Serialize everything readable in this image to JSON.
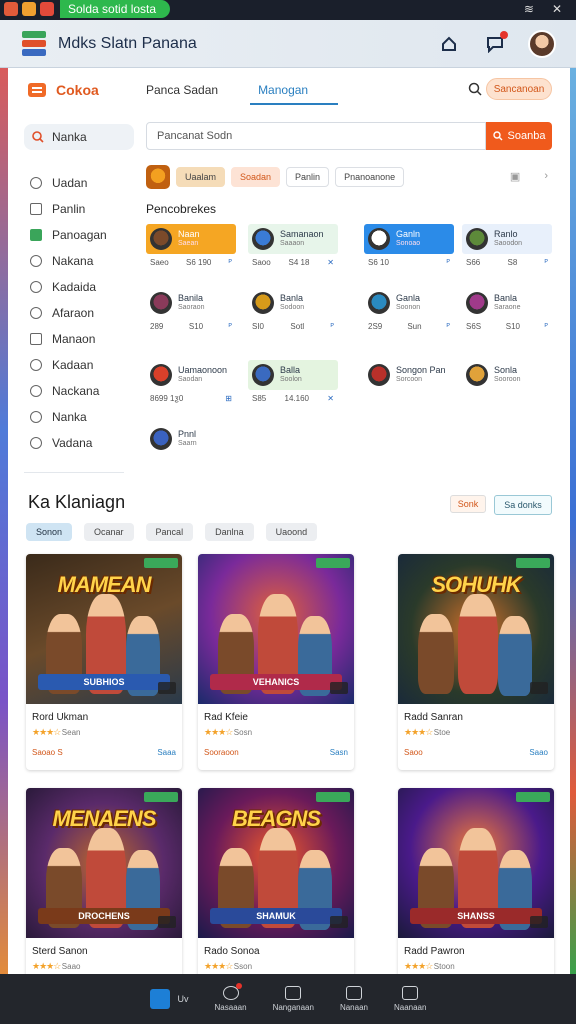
{
  "status": {
    "pill_label": "Solda sotid losta"
  },
  "app": {
    "title": "Mdks Slatn Panana"
  },
  "sidebar": {
    "brand": "Cokoa",
    "search_label": "Nanka",
    "items": [
      {
        "label": "Uadan",
        "icon": "search-icon"
      },
      {
        "label": "Panlin",
        "icon": "doc-icon"
      },
      {
        "label": "Panoagan",
        "icon": "flag-icon"
      },
      {
        "label": "Nakana",
        "icon": "circle-icon"
      },
      {
        "label": "Kadaida",
        "icon": "circle-icon"
      },
      {
        "label": "Afaraon",
        "icon": "clock-icon"
      },
      {
        "label": "Manaon",
        "icon": "doc-icon"
      },
      {
        "label": "Kadaan",
        "icon": "chat-icon"
      },
      {
        "label": "Nackana",
        "icon": "settings-icon"
      },
      {
        "label": "Nanka",
        "icon": "info-icon"
      },
      {
        "label": "Vadana",
        "icon": "gear-icon"
      }
    ]
  },
  "tabs": [
    "Panca Sadan",
    "Manogan"
  ],
  "top_pill": "Sancanoan",
  "search": {
    "placeholder": "Pancanat Sodn",
    "button": "Soanba"
  },
  "chips": [
    "Uaalam",
    "Soadan",
    "Panlin",
    "Pnanoanone"
  ],
  "section_label": "Pencobrekes",
  "mini_cards": [
    {
      "name": "Naan",
      "sub": "Saean",
      "m1": "Saeo",
      "m2": "S6 190",
      "m3": "ᴾ",
      "color": "#f5a623",
      "text": "#fff",
      "icon": "#7b4a2a"
    },
    {
      "name": "Samanaon",
      "sub": "Saaaon",
      "m1": "Saoo",
      "m2": "S4 18",
      "m3": "✕",
      "color": "#e7f5ea",
      "text": "#2d3a4a",
      "icon": "#3a7bd5"
    },
    {
      "name": "Ganln",
      "sub": "Sonoao",
      "m1": "S6 10",
      "m2": "",
      "m3": "ᴾ",
      "color": "#2b8be8",
      "text": "#fff",
      "icon": "#ffffff"
    },
    {
      "name": "Ranlo",
      "sub": "Saoodon",
      "m1": "S66",
      "m2": "S8",
      "m3": "ᴾ",
      "color": "#e8f0fb",
      "text": "#2d3a4a",
      "icon": "#5d8a3a"
    },
    {
      "name": "Banila",
      "sub": "Saoraon",
      "m1": "289",
      "m2": "S10",
      "m3": "ᴾ",
      "color": "#ffffff",
      "text": "#2d3a4a",
      "icon": "#8a3a5a"
    },
    {
      "name": "Banla",
      "sub": "Sodoon",
      "m1": "SI0",
      "m2": "Sotl",
      "m3": "ᴾ",
      "color": "#ffffff",
      "text": "#2d3a4a",
      "icon": "#d69a1a"
    },
    {
      "name": "Ganla",
      "sub": "Soonon",
      "m1": "2S9",
      "m2": "Sun",
      "m3": "ᴾ",
      "color": "#ffffff",
      "text": "#2d3a4a",
      "icon": "#2a8ac0"
    },
    {
      "name": "Banla",
      "sub": "Saraone",
      "m1": "S6S",
      "m2": "S10",
      "m3": "ᴾ",
      "color": "#ffffff",
      "text": "#2d3a4a",
      "icon": "#a03a8a"
    },
    {
      "name": "Uamaonoon",
      "sub": "Saodan",
      "m1": "8699 1ƺ0",
      "m2": "",
      "m3": "⊞",
      "color": "#ffffff",
      "text": "#2d3a4a",
      "icon": "#d9402a"
    },
    {
      "name": "Balla",
      "sub": "Soolon",
      "m1": "S85",
      "m2": "14.160",
      "m3": "✕",
      "color": "#e4f4e0",
      "text": "#2d3a4a",
      "icon": "#3a6ac0"
    },
    {
      "name": "Songon Pan",
      "sub": "Sorcoon",
      "m1": "",
      "m2": "",
      "m3": "",
      "color": "#ffffff",
      "text": "#2d3a4a",
      "icon": "#b8302a"
    },
    {
      "name": "Sonla",
      "sub": "Sooroon",
      "m1": "",
      "m2": "",
      "m3": "",
      "color": "#ffffff",
      "text": "#2d3a4a",
      "icon": "#e0a23a"
    },
    {
      "name": "Pnnl",
      "sub": "Saarn",
      "m1": "",
      "m2": "",
      "m3": "",
      "color": "#ffffff",
      "text": "#2d3a4a",
      "icon": "#3a62c0"
    }
  ],
  "ka_section": {
    "title": "Ka Klaniagn",
    "btn1": "Sonk",
    "btn2": "Sa donks"
  },
  "filters": [
    "Sonon",
    "Ocanar",
    "Pancal",
    "Danlna",
    "Uaoond"
  ],
  "games": [
    {
      "title_art": "MAMEAN",
      "sub_art": "SUBHIOS",
      "name": "Rord Ukman",
      "rating_text": "Sean",
      "foot_left": "Saoao S",
      "foot_right": "Saaa",
      "bg": "linear-gradient(160deg,#3a2a1a,#6a4a2a 50%,#2a3a4a)",
      "sub_bg": "#2a5ab0"
    },
    {
      "title_art": "",
      "sub_art": "VEHANICS",
      "name": "Rad Kfeie",
      "rating_text": "Sosn",
      "foot_left": "Sooraoon",
      "foot_right": "Sasn",
      "bg": "radial-gradient(circle at 50% 40%,#e0603a,#7a2a9a 55%,#1a2a6a)",
      "sub_bg": "#b02a4a"
    },
    {
      "title_art": "SOHUHK",
      "sub_art": "",
      "name": "Radd Sanran",
      "rating_text": "Stoe",
      "foot_left": "Saoo",
      "foot_right": "Saao",
      "bg": "radial-gradient(circle at 50% 50%,#d0702a,#2a3a2a 60%,#1a2a3a)",
      "sub_bg": "#3a3a3a"
    },
    {
      "title_art": "MENAENS",
      "sub_art": "DROCHENS",
      "name": "Sterd Sanon",
      "rating_text": "Saao",
      "foot_left": "",
      "foot_right": "",
      "bg": "radial-gradient(circle at 50% 50%,#c06a2a,#5a2a6a 55%,#2a1a3a)",
      "sub_bg": "#7a3a1a"
    },
    {
      "title_art": "BEAGNS",
      "sub_art": "SHAMUK",
      "name": "Rado Sonoa",
      "rating_text": "Sson",
      "foot_left": "",
      "foot_right": "",
      "bg": "radial-gradient(circle at 50% 45%,#f05a2a,#6a1a5a 55%,#1a1a4a)",
      "sub_bg": "#2a4a9a"
    },
    {
      "title_art": "",
      "sub_art": "SHANSS",
      "name": "Radd Pawron",
      "rating_text": "Stoon",
      "foot_left": "",
      "foot_right": "",
      "bg": "radial-gradient(circle at 50% 40%,#f07a3a,#4a1a8a 55%,#1a1a3a)",
      "sub_bg": "#9a2a2a"
    }
  ],
  "bottom_nav": [
    {
      "label": "Uv",
      "icon": "store-icon"
    },
    {
      "label": "Nasaaan",
      "icon": "compass-icon"
    },
    {
      "label": "Nanganaan",
      "icon": "people-icon"
    },
    {
      "label": "Nanaan",
      "icon": "library-icon"
    },
    {
      "label": "Naanaan",
      "icon": "profile-icon"
    }
  ]
}
